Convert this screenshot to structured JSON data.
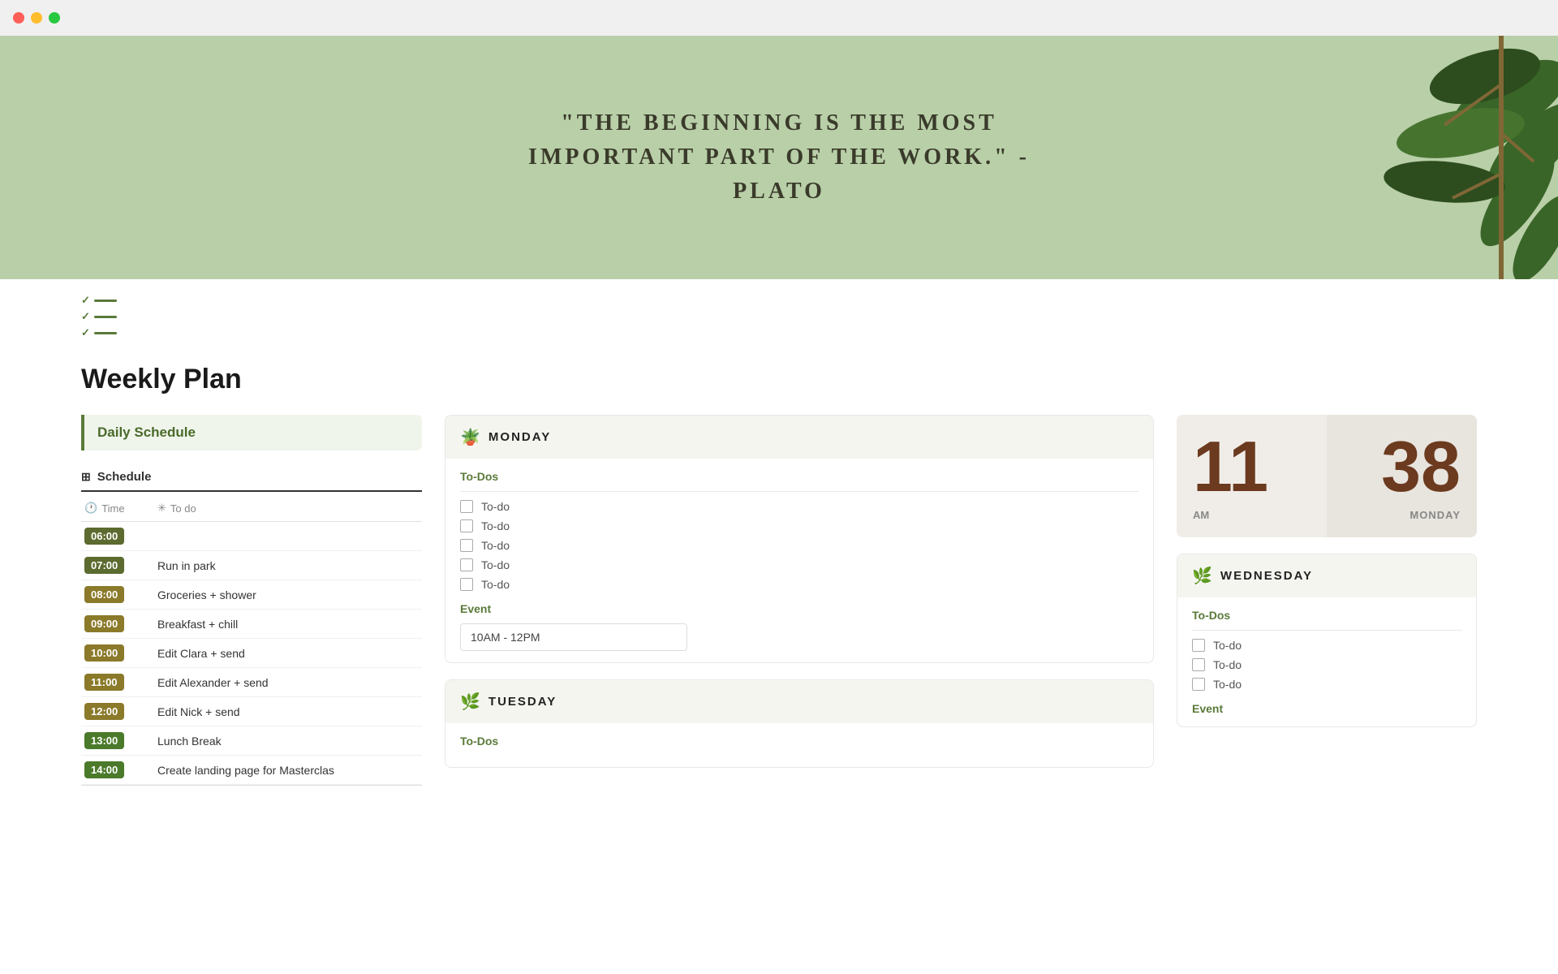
{
  "titlebar": {
    "close_color": "#ff5f57",
    "minimize_color": "#ffbd2e",
    "maximize_color": "#28c840"
  },
  "hero": {
    "quote": "\"The Beginning is the Most Important Part of the Work.\" - Plato"
  },
  "page": {
    "title": "Weekly Plan"
  },
  "sidebar": {
    "tab_label": "Daily Schedule",
    "schedule_label": "Schedule",
    "col_time": "Time",
    "col_todo": "To do",
    "rows": [
      {
        "time": "06:00",
        "color": "#5c6b2f",
        "task": ""
      },
      {
        "time": "07:00",
        "color": "#5c6b2f",
        "task": "Run in park"
      },
      {
        "time": "08:00",
        "color": "#8a7a2a",
        "task": "Groceries + shower"
      },
      {
        "time": "09:00",
        "color": "#8a7a2a",
        "task": "Breakfast + chill"
      },
      {
        "time": "10:00",
        "color": "#8a7a2a",
        "task": "Edit Clara + send"
      },
      {
        "time": "11:00",
        "color": "#8a7a2a",
        "task": "Edit Alexander + send"
      },
      {
        "time": "12:00",
        "color": "#8a7a2a",
        "task": "Edit Nick + send"
      },
      {
        "time": "13:00",
        "color": "#4a7a2a",
        "task": "Lunch Break"
      },
      {
        "time": "14:00",
        "color": "#4a7a2a",
        "task": "Create landing page for Masterclas"
      }
    ]
  },
  "monday": {
    "icon": "🪴",
    "name": "MONDAY",
    "todos_title": "To-Dos",
    "todos": [
      "To-do",
      "To-do",
      "To-do",
      "To-do",
      "To-do"
    ],
    "event_title": "Event",
    "event_time": "10AM - 12PM"
  },
  "tuesday": {
    "icon": "🌿",
    "name": "TUESDAY",
    "todos_title": "To-Dos"
  },
  "clock": {
    "hour": "11",
    "minutes": "38",
    "am_pm": "AM",
    "day": "MONDAY"
  },
  "wednesday": {
    "icon": "🌿",
    "name": "WEDNESDAY",
    "todos_title": "To-Dos",
    "todos": [
      "To-do",
      "To-do",
      "To-do"
    ],
    "event_title": "Event"
  }
}
